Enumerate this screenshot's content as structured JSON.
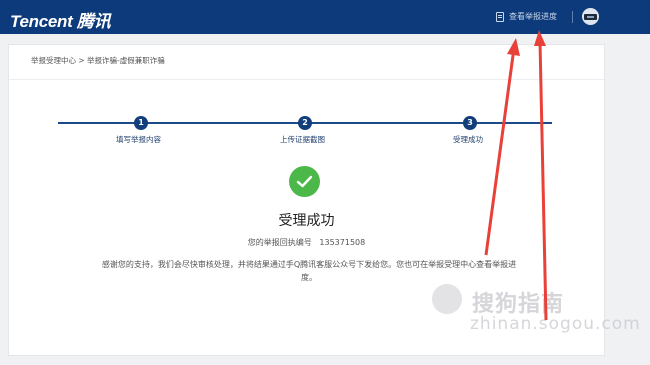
{
  "header": {
    "logo_text": "Tencent 腾讯",
    "progress_link": "查看举报进度",
    "doc_icon": "document-icon",
    "avatar_icon": "user-avatar"
  },
  "breadcrumb": "举报受理中心 > 举报诈骗-虚假兼职诈骗",
  "steps": [
    {
      "number": "1",
      "label": "填写举报内容"
    },
    {
      "number": "2",
      "label": "上传证据截图"
    },
    {
      "number": "3",
      "label": "受理成功"
    }
  ],
  "result": {
    "icon": "check-icon",
    "title": "受理成功",
    "ref_label": "您的举报回执编号",
    "ref_number": "135371508",
    "message": "感谢您的支持，我们会尽快审核处理，并将结果通过手Q腾讯客服公众号下发给您。您也可在举报受理中心查看举报进度。"
  },
  "watermark": {
    "cn": "搜狗指南",
    "en": "zhinan.sogou.com"
  },
  "colors": {
    "header_bg": "#0c3a7a",
    "step": "#123e7c",
    "success": "#4cb84a",
    "arrow": "#e8413a"
  }
}
